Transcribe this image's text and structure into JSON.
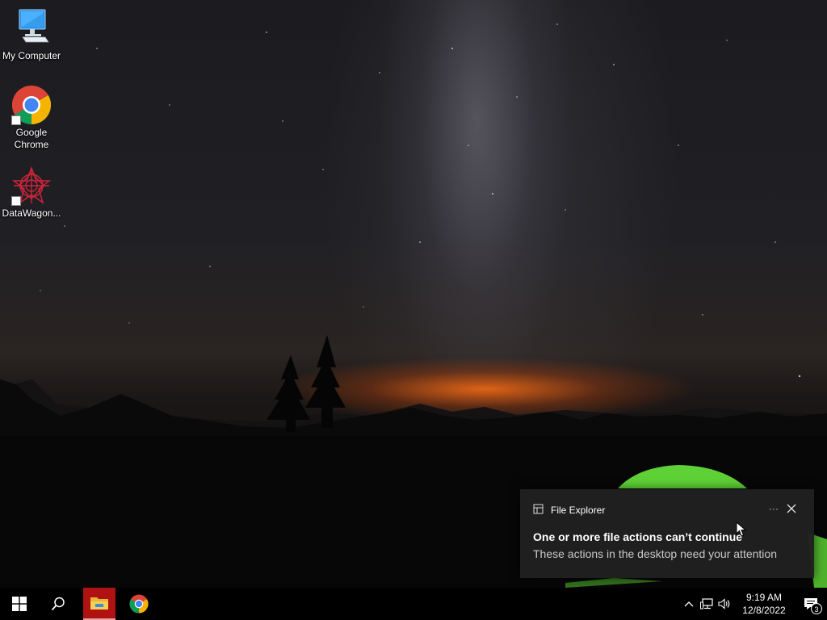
{
  "desktop": {
    "icons": [
      {
        "label": "My Computer",
        "icon": "monitor-icon"
      },
      {
        "label": "Google Chrome",
        "icon": "chrome-icon"
      },
      {
        "label": "DataWagon...",
        "icon": "datawagon-icon"
      }
    ]
  },
  "toast": {
    "app_name": "File Explorer",
    "title": "One or more file actions can’t continue",
    "body": "These actions in the desktop need your attention",
    "more_label": "···"
  },
  "taskbar": {
    "pinned": [
      "start-icon",
      "search-icon",
      "file-explorer-icon",
      "chrome-icon"
    ],
    "tray": {
      "time": "9:19 AM",
      "date": "12/8/2022",
      "notification_count": "3"
    }
  },
  "colors": {
    "taskbar": "#000000",
    "explorer_active": "#b01212",
    "toast_bg": "#202020",
    "tent_green": "#5ed136"
  }
}
